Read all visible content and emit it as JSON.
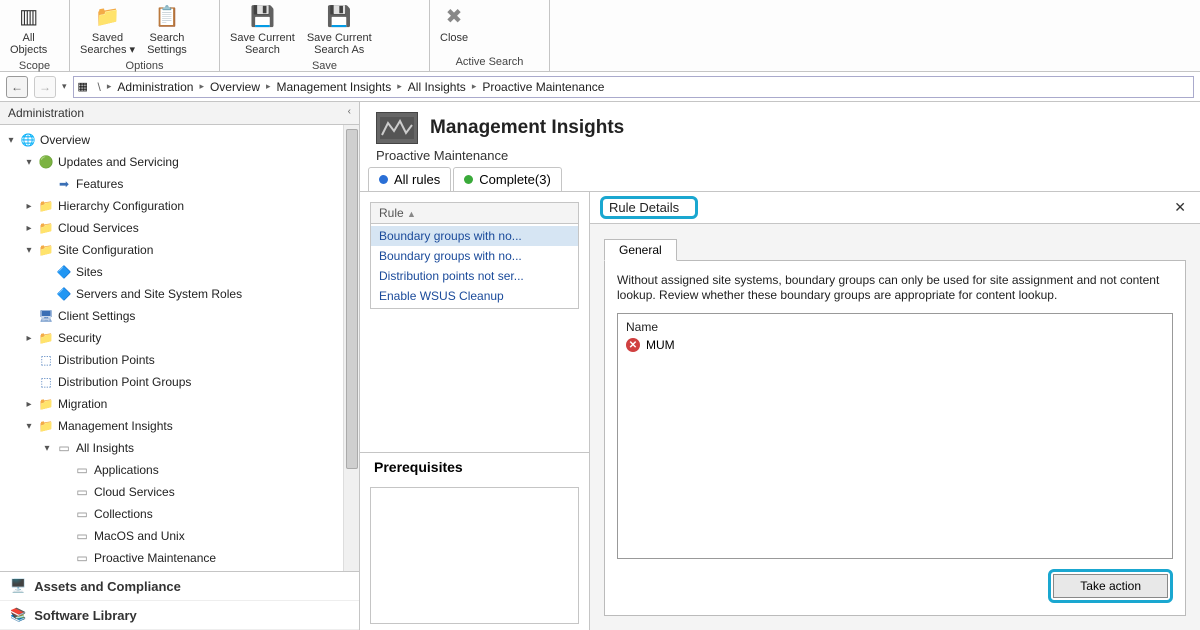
{
  "ribbon": {
    "groups": [
      {
        "label": "Scope",
        "buttons": [
          {
            "label": "All\nObjects"
          }
        ]
      },
      {
        "label": "Options",
        "buttons": [
          {
            "label": "Saved\nSearches ▾"
          },
          {
            "label": "Search\nSettings"
          }
        ]
      },
      {
        "label": "Save",
        "buttons": [
          {
            "label": "Save Current\nSearch"
          },
          {
            "label": "Save Current\nSearch As"
          }
        ]
      },
      {
        "label": "Active Search",
        "buttons": [
          {
            "label": "Close"
          }
        ]
      }
    ]
  },
  "breadcrumb": [
    "Administration",
    "Overview",
    "Management Insights",
    "All Insights",
    "Proactive Maintenance"
  ],
  "sidebar": {
    "title": "Administration",
    "tree": [
      {
        "indent": 0,
        "exp": "▾",
        "icon": "globe",
        "label": "Overview"
      },
      {
        "indent": 1,
        "exp": "▾",
        "icon": "green",
        "label": "Updates and Servicing"
      },
      {
        "indent": 2,
        "exp": "",
        "icon": "feat",
        "label": "Features"
      },
      {
        "indent": 1,
        "exp": "▸",
        "icon": "folder",
        "label": "Hierarchy Configuration"
      },
      {
        "indent": 1,
        "exp": "▸",
        "icon": "folder",
        "label": "Cloud Services"
      },
      {
        "indent": 1,
        "exp": "▾",
        "icon": "folder",
        "label": "Site Configuration"
      },
      {
        "indent": 2,
        "exp": "",
        "icon": "sites",
        "label": "Sites"
      },
      {
        "indent": 2,
        "exp": "",
        "icon": "sites",
        "label": "Servers and Site System Roles"
      },
      {
        "indent": 1,
        "exp": "",
        "icon": "client",
        "label": "Client Settings"
      },
      {
        "indent": 1,
        "exp": "▸",
        "icon": "folder",
        "label": "Security"
      },
      {
        "indent": 1,
        "exp": "",
        "icon": "dp",
        "label": "Distribution Points"
      },
      {
        "indent": 1,
        "exp": "",
        "icon": "dp",
        "label": "Distribution Point Groups"
      },
      {
        "indent": 1,
        "exp": "▸",
        "icon": "folder",
        "label": "Migration"
      },
      {
        "indent": 1,
        "exp": "▾",
        "icon": "folder",
        "label": "Management Insights"
      },
      {
        "indent": 2,
        "exp": "▾",
        "icon": "doc",
        "label": "All Insights"
      },
      {
        "indent": 3,
        "exp": "",
        "icon": "doc",
        "label": "Applications"
      },
      {
        "indent": 3,
        "exp": "",
        "icon": "doc",
        "label": "Cloud Services"
      },
      {
        "indent": 3,
        "exp": "",
        "icon": "doc",
        "label": "Collections"
      },
      {
        "indent": 3,
        "exp": "",
        "icon": "doc",
        "label": "MacOS and Unix"
      },
      {
        "indent": 3,
        "exp": "",
        "icon": "doc",
        "label": "Proactive Maintenance"
      }
    ],
    "bottom": [
      {
        "label": "Assets and Compliance"
      },
      {
        "label": "Software Library"
      }
    ]
  },
  "content": {
    "title": "Management Insights",
    "subtitle": "Proactive Maintenance",
    "tabs": {
      "all": "All rules",
      "complete": "Complete(3)"
    },
    "list_header": "Rule",
    "rules": [
      "Boundary groups with no...",
      "Boundary groups with no...",
      "Distribution points not ser...",
      "Enable WSUS Cleanup"
    ],
    "prereq_title": "Prerequisites",
    "detail": {
      "title": "Rule Details",
      "tab": "General",
      "description": "Without assigned site systems, boundary groups can only be used for site assignment and not content lookup. Review whether these boundary groups are appropriate for content lookup.",
      "name_label": "Name",
      "name_value": "MUM",
      "action": "Take action"
    }
  }
}
